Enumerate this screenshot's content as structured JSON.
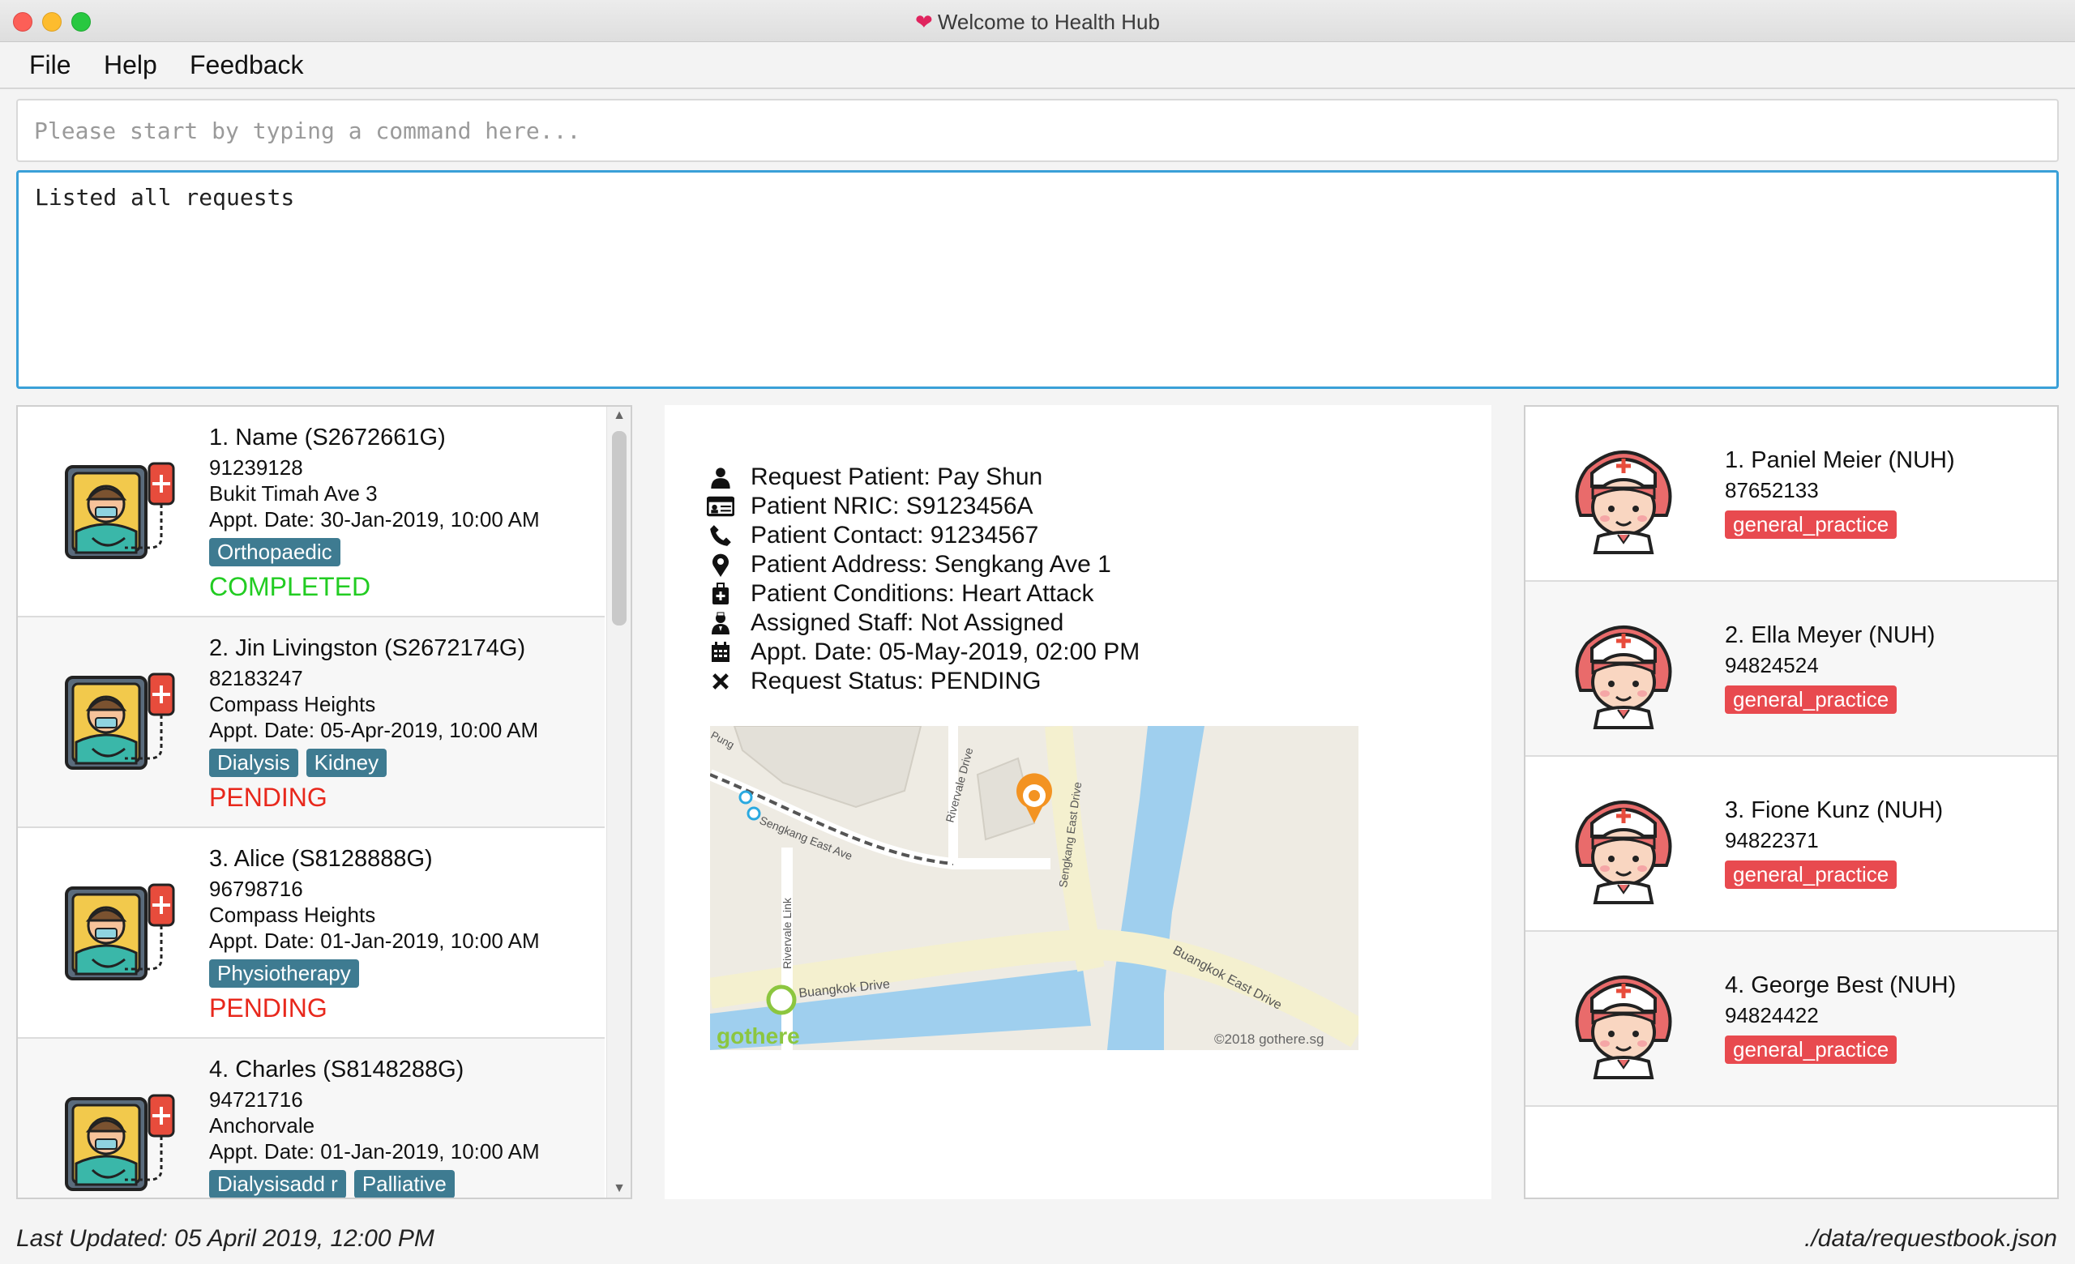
{
  "window": {
    "title": "Welcome to Health Hub"
  },
  "menu": [
    "File",
    "Help",
    "Feedback"
  ],
  "command": {
    "placeholder": "Please start by typing a command here..."
  },
  "result": {
    "text": "Listed all requests"
  },
  "requests": [
    {
      "title": "1.  Name  (S2672661G)",
      "phone": "91239128",
      "address": "Bukit Timah Ave 3",
      "date": "Appt. Date: 30-Jan-2019, 10:00 AM",
      "tags": [
        "Orthopaedic"
      ],
      "status": "COMPLETED"
    },
    {
      "title": "2.  Jin Livingston  (S2672174G)",
      "phone": "82183247",
      "address": "Compass Heights",
      "date": "Appt. Date: 05-Apr-2019, 10:00 AM",
      "tags": [
        "Dialysis",
        "Kidney"
      ],
      "status": "PENDING"
    },
    {
      "title": "3.  Alice  (S8128888G)",
      "phone": "96798716",
      "address": "Compass Heights",
      "date": "Appt. Date: 01-Jan-2019, 10:00 AM",
      "tags": [
        "Physiotherapy"
      ],
      "status": "PENDING"
    },
    {
      "title": "4.  Charles  (S8148288G)",
      "phone": "94721716",
      "address": "Anchorvale",
      "date": "Appt. Date: 01-Jan-2019, 10:00 AM",
      "tags": [
        "Dialysisadd r",
        "Palliative"
      ],
      "status": ""
    }
  ],
  "colors": {
    "completed": "#22cc22",
    "pending": "#e8281c",
    "accent": "#3aa0d8",
    "tag": "#3e7b91",
    "staff_tag": "#e84a4f"
  },
  "details": [
    {
      "icon": "user-icon",
      "label": "Request Patient: Pay Shun"
    },
    {
      "icon": "id-card-icon",
      "label": "Patient NRIC: S9123456A"
    },
    {
      "icon": "phone-icon",
      "label": "Patient Contact: 91234567"
    },
    {
      "icon": "map-pin-icon",
      "label": "Patient Address: Sengkang Ave 1"
    },
    {
      "icon": "medkit-icon",
      "label": "Patient Conditions: Heart Attack"
    },
    {
      "icon": "staff-icon",
      "label": "Assigned Staff: Not Assigned"
    },
    {
      "icon": "calendar-icon",
      "label": "Appt. Date: 05-May-2019, 02:00 PM"
    },
    {
      "icon": "close-icon",
      "label": "Request Status: PENDING"
    }
  ],
  "map": {
    "roads": [
      "Sengkang East Ave",
      "Rivervale Drive",
      "Sengkang East Drive",
      "Rivervale Link",
      "Buangkok Drive",
      "Buangkok East Drive",
      "Pung"
    ],
    "brand": "gothere",
    "copyright": "©2018 gothere.sg"
  },
  "staff": [
    {
      "name": "1.  Paniel Meier  (NUH)",
      "phone": "87652133",
      "tag": "general_practice"
    },
    {
      "name": "2.  Ella Meyer  (NUH)",
      "phone": "94824524",
      "tag": "general_practice"
    },
    {
      "name": "3.  Fione Kunz  (NUH)",
      "phone": "94822371",
      "tag": "general_practice"
    },
    {
      "name": "4.  George Best  (NUH)",
      "phone": "94824422",
      "tag": "general_practice"
    }
  ],
  "footer": {
    "last_updated": "Last Updated: 05 April 2019, 12:00 PM",
    "file": "./data/requestbook.json"
  }
}
